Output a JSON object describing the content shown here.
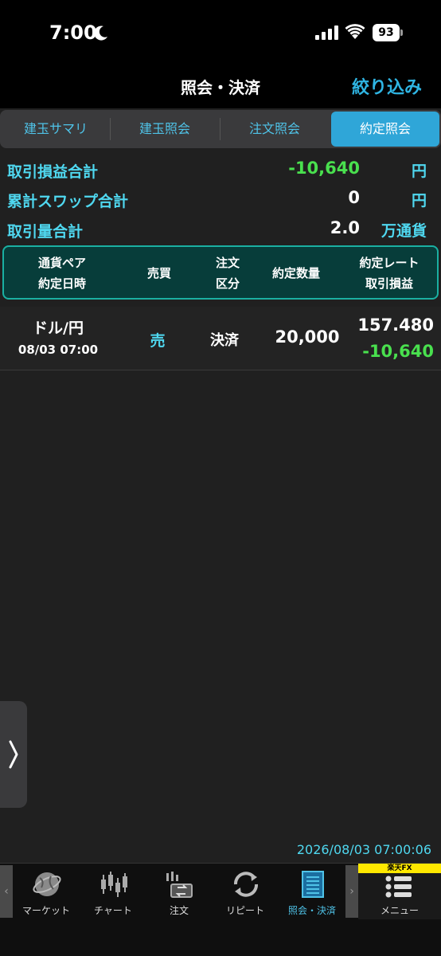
{
  "status": {
    "time": "7:00",
    "battery": "93"
  },
  "nav": {
    "title": "照会・決済",
    "filter": "絞り込み"
  },
  "tabs": [
    {
      "label": "建玉サマリ"
    },
    {
      "label": "建玉照会"
    },
    {
      "label": "注文照会"
    },
    {
      "label": "約定照会"
    }
  ],
  "summary": {
    "pnl": {
      "label": "取引損益合計",
      "value": "-10,640",
      "unit": "円"
    },
    "swap": {
      "label": "累計スワップ合計",
      "value": "0",
      "unit": "円"
    },
    "volume": {
      "label": "取引量合計",
      "value": "2.0",
      "unit": "万通貨"
    }
  },
  "table": {
    "headers": {
      "pair": "通貨ペア",
      "date": "約定日時",
      "side": "売買",
      "type1": "注文",
      "type2": "区分",
      "qty": "約定数量",
      "rate": "約定レート",
      "pnl": "取引損益"
    },
    "rows": [
      {
        "pair": "ドル/円",
        "date": "08/03 07:00",
        "side": "売",
        "type": "決済",
        "qty": "20,000",
        "rate": "157.480",
        "pnl": "-10,640"
      }
    ]
  },
  "timestamp": "2026/08/03 07:00:06",
  "bottom_nav": [
    {
      "label": "マーケット",
      "icon": "globe-icon"
    },
    {
      "label": "チャート",
      "icon": "candlestick-icon"
    },
    {
      "label": "注文",
      "icon": "order-icon"
    },
    {
      "label": "リピート",
      "icon": "repeat-icon"
    },
    {
      "label": "照会・決済",
      "icon": "document-icon"
    },
    {
      "label": "メニュー",
      "icon": "menu-list-icon"
    }
  ],
  "brand": "楽天FX",
  "colors": {
    "accent": "#2fb5e3",
    "positive": "#49e04e",
    "label": "#4fd8f0",
    "header_bg": "#073d3a"
  }
}
